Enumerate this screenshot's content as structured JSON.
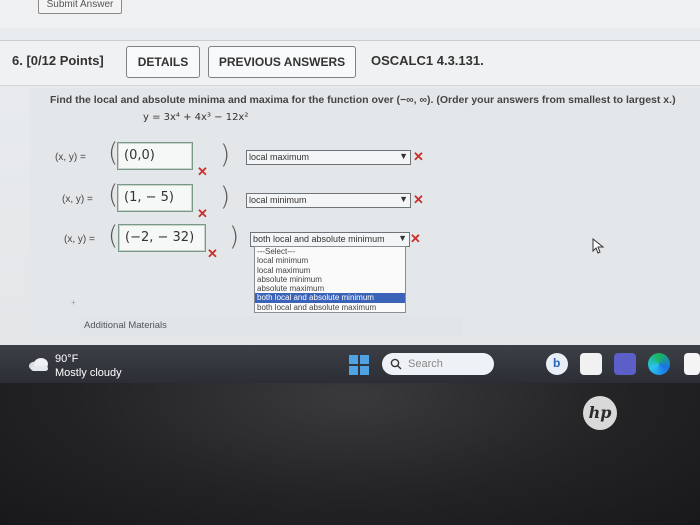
{
  "submit_button": "Submit Answer",
  "question": {
    "number": "6. [0/12 Points]",
    "details_label": "DETAILS",
    "previous_answers_label": "PREVIOUS ANSWERS",
    "code": "OSCALC1 4.3.131.",
    "prompt": "Find the local and absolute minima and maxima for the function over (−∞, ∞). (Order your answers from smallest to largest x.)",
    "function": "y = 3x⁴ + 4x³ − 12x²",
    "rows": [
      {
        "label": "(x, y) =",
        "answer": "(0,0)",
        "selection": "local maximum",
        "mark": "✕"
      },
      {
        "label": "(x, y) =",
        "answer": "(1, − 5)",
        "selection": "local minimum",
        "mark": "✕"
      },
      {
        "label": "(x, y) =",
        "answer": "(−2, − 32)",
        "selection": "both local and absolute minimum",
        "mark": "✕"
      }
    ],
    "dropdown_options": [
      "---Select---",
      "local minimum",
      "local maximum",
      "absolute minimum",
      "absolute maximum",
      "both local and absolute minimum",
      "both local and absolute maximum"
    ],
    "dropdown_highlighted_index": 5,
    "additional_materials": "Additional Materials"
  },
  "taskbar": {
    "temperature": "90°F",
    "condition": "Mostly cloudy",
    "search_placeholder": "Search"
  },
  "laptop_logo": "hp",
  "colors": {
    "error": "#c9302c",
    "highlight": "#3b63b8",
    "edge_blue": "#1a73e8"
  }
}
